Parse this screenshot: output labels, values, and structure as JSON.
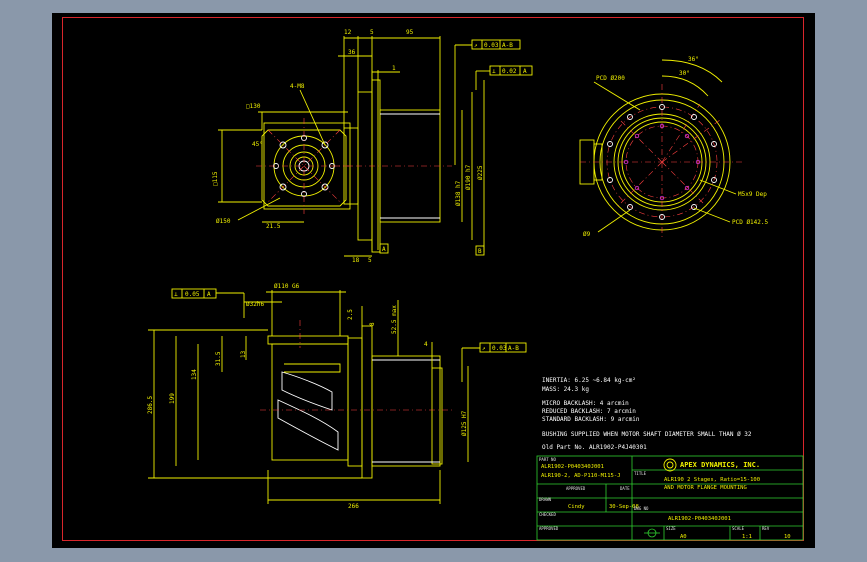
{
  "dimensions_top": {
    "d12": "12",
    "d5": "5",
    "d95": "95",
    "d36": "36",
    "d1": "1",
    "sq130": "□130",
    "holes": "4-M8",
    "ang45": "45°",
    "sq115": "□115",
    "dia150": "Ø150",
    "d215": "21.5",
    "dia138": "Ø138 h7",
    "dia190": "Ø190 h7",
    "dia225": "Ø225",
    "d18": "18",
    "d5b": "5",
    "tol_run": "0.03",
    "tol_run_ref": "A-B",
    "tol_perp": "0.02",
    "tol_perp_ref": "A",
    "datum_a": "A",
    "datum_b": "B"
  },
  "dimensions_right": {
    "pcd200": "PCD Ø200",
    "ang36": "36°",
    "ang30": "30°",
    "tap": "M5x9 Dep",
    "pcd1425": "PCD Ø142.5",
    "dia9": "Ø9"
  },
  "dimensions_bottom": {
    "tol_flat": "0.05",
    "tol_flat_ref": "A",
    "dia110": "Ø110 G6",
    "dia32": "Ø32h6",
    "d25": "2.5",
    "d8": "8",
    "d525": "52.5 max",
    "d13": "13",
    "d315": "31.5",
    "d134": "134",
    "d199": "199",
    "d2865": "286.5",
    "d4": "4",
    "dia125": "Ø125 H7",
    "d266": "266",
    "tol_run2": "0.03",
    "tol_run2_ref": "A-B"
  },
  "notes": [
    "INERTIA: 6.25 ~6.84 kg-cm²",
    "MASS: 24.3 kg",
    "MICRO BACKLASH: 4 arcmin",
    "REDUCED BACKLASH: 7 arcmin",
    "STANDARD BACKLASH: 9 arcmin",
    "BUSHING SUPPLIED WHEN MOTOR SHAFT DIAMETER SMALL THAN Ø 32",
    "Old Part No. ALR1902-P4J40301"
  ],
  "title_block": {
    "part_no_label": "PART NO",
    "part_no": "ALR1902-P040340J001",
    "desc": "ALR190-2, AD-P110-M115-J",
    "company": "APEX DYNAMICS, INC.",
    "title_label": "TITLE",
    "title_line1": "ALR190 2 Stages, Ratio=15-100",
    "title_line2": "AND MOTOR FLANGE MOUNTING",
    "approved_label": "APPROVED",
    "date_label": "DATE",
    "drawn_label": "DRAWN",
    "drawn_by": "Cindy",
    "drawn_date": "30-Sep-08",
    "checked_label": "CHECKED",
    "dwg_label": "DWG NO",
    "dwg_no": "ALR1902-P040340J001",
    "approved2_label": "APPROVED",
    "size_label": "SIZE",
    "size": "A0",
    "scale_label": "SCALE",
    "scale": "1:1",
    "rev_label": "REV",
    "rev": "10"
  }
}
